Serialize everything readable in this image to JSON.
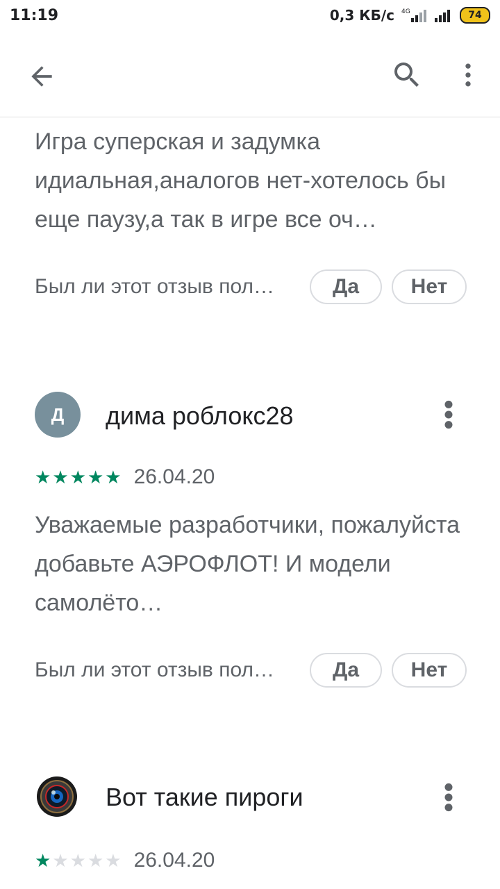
{
  "status_bar": {
    "time": "11:19",
    "net_speed": "0,3 КБ/с",
    "network_type": "4G",
    "battery": "74"
  },
  "app_bar": {
    "back_icon": "arrow-back-icon",
    "search_icon": "search-icon",
    "more_icon": "more-vert-icon"
  },
  "reviews": [
    {
      "text": "Игра суперская и задумка идиальная,аналогов нет-хотелось бы еще паузу,а так в игре все оч…",
      "helpful_question": "Был ли этот отзыв пол…",
      "yes_label": "Да",
      "no_label": "Нет"
    },
    {
      "author": "дима роблокс28",
      "avatar_letter": "Д",
      "avatar_color": "#78909c",
      "rating": 5,
      "date": "26.04.20",
      "text": "Уважаемые разработчики, пожалуйста добавьте АЭРОФЛОТ! И модели самолёто…",
      "helpful_question": "Был ли этот отзыв пол…",
      "yes_label": "Да",
      "no_label": "Нет"
    },
    {
      "author": "Вот такие пироги",
      "avatar_icon": "camera-lens-avatar-icon",
      "rating": 1,
      "date": "26.04.20"
    }
  ],
  "colors": {
    "star_filled": "#01875f",
    "star_empty": "#dadce0",
    "text_secondary": "#5f6368",
    "text_primary": "#202124"
  }
}
